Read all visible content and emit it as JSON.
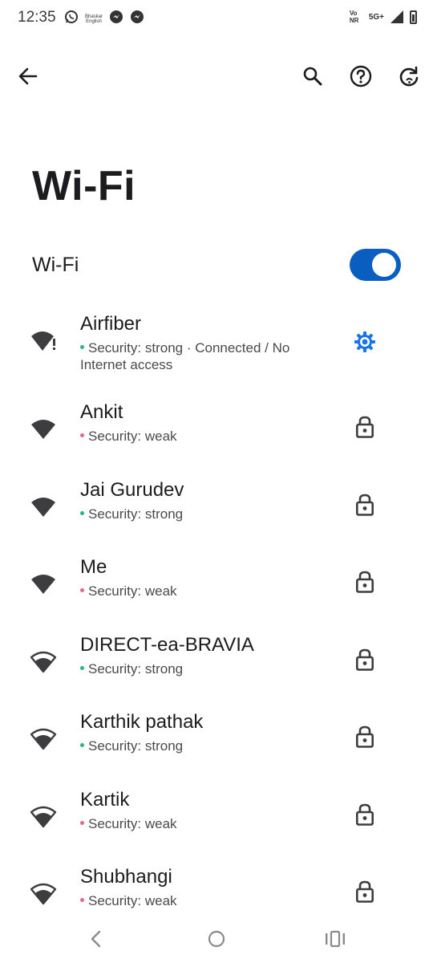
{
  "status_bar": {
    "time": "12:35",
    "app_badge_text": "Bhaskar English",
    "network_label_1": "Vo NR",
    "network_label_2": "5G+"
  },
  "top_bar": {
    "icons": [
      "arrow-back-icon",
      "search-icon",
      "help-icon",
      "reset-icon"
    ]
  },
  "page": {
    "title": "Wi-Fi",
    "toggle_label": "Wi-Fi",
    "toggle_on": true,
    "accent_color": "#0a5ec0"
  },
  "networks": [
    {
      "name": "Airfiber",
      "security": "Security: strong · Connected / No Internet access",
      "security_level": "strong",
      "trailing": "gear-icon",
      "signal": "full-no-internet"
    },
    {
      "name": "Ankit",
      "security": "Security: weak",
      "security_level": "weak",
      "trailing": "lock-icon",
      "signal": "full"
    },
    {
      "name": "Jai Gurudev",
      "security": "Security: strong",
      "security_level": "strong",
      "trailing": "lock-icon",
      "signal": "full"
    },
    {
      "name": "Me",
      "security": "Security: weak",
      "security_level": "weak",
      "trailing": "lock-icon",
      "signal": "full"
    },
    {
      "name": "DIRECT-ea-BRAVIA",
      "security": "Security: strong",
      "security_level": "strong",
      "trailing": "lock-icon",
      "signal": "medium"
    },
    {
      "name": "Karthik pathak",
      "security": "Security: strong",
      "security_level": "strong",
      "trailing": "lock-icon",
      "signal": "medium"
    },
    {
      "name": "Kartik",
      "security": "Security: weak",
      "security_level": "weak",
      "trailing": "lock-icon",
      "signal": "medium"
    },
    {
      "name": "Shubhangi",
      "security": "Security: weak",
      "security_level": "weak",
      "trailing": "lock-icon",
      "signal": "medium"
    }
  ],
  "colors": {
    "strong_dot": "#2bb38a",
    "weak_dot": "#e06a8c"
  },
  "nav_bar": {
    "icons": [
      "nav-back-icon",
      "nav-home-icon",
      "nav-recents-icon"
    ]
  }
}
